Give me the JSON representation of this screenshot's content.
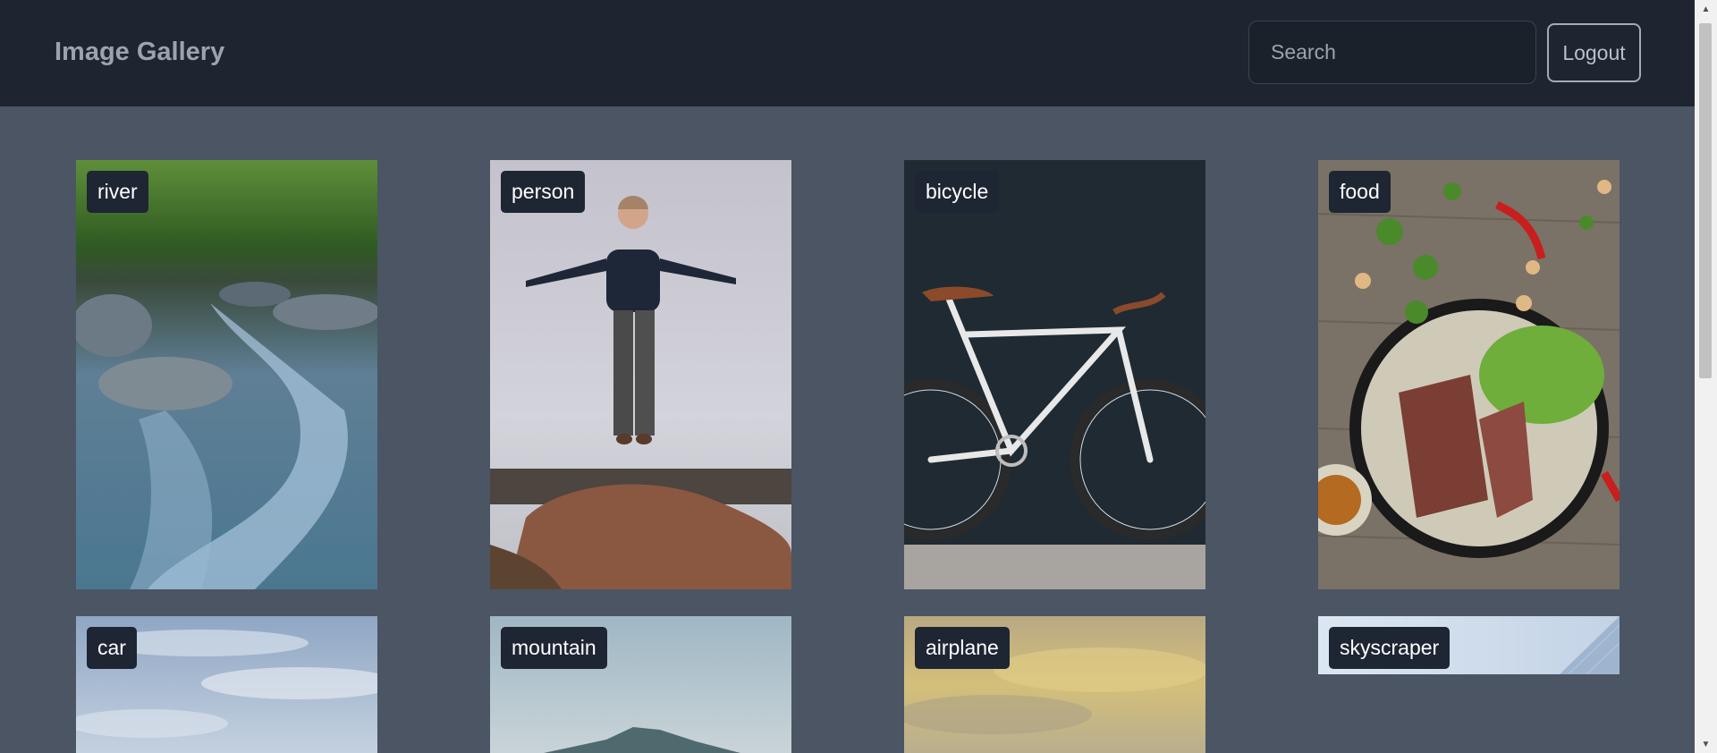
{
  "header": {
    "brand": "Image Gallery",
    "search_placeholder": "Search",
    "logout_label": "Logout"
  },
  "gallery": {
    "items": [
      {
        "label": "river"
      },
      {
        "label": "person"
      },
      {
        "label": "bicycle"
      },
      {
        "label": "food"
      },
      {
        "label": "car"
      },
      {
        "label": "mountain"
      },
      {
        "label": "airplane"
      },
      {
        "label": "skyscraper"
      }
    ]
  },
  "colors": {
    "navbar": "#1f2530",
    "page_background": "#4b5563",
    "label_background": "#1e2533"
  }
}
